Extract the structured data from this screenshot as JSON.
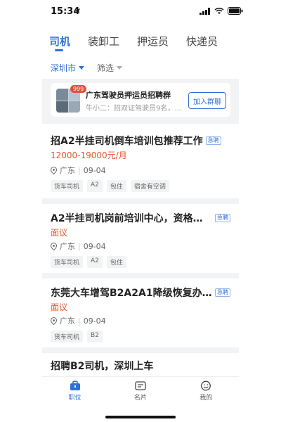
{
  "status": {
    "time": "15:34"
  },
  "tabs": [
    {
      "label": "司机",
      "active": true
    },
    {
      "label": "装卸工",
      "active": false
    },
    {
      "label": "押运员",
      "active": false
    },
    {
      "label": "快递员",
      "active": false
    }
  ],
  "filters": {
    "city": "深圳市",
    "filter": "筛选"
  },
  "group": {
    "badge": "999",
    "title": "广东驾驶员押运员招聘群",
    "subtitle": "牛小二：招双证驾驶员9名，工资…",
    "join_label": "加入群聊"
  },
  "jobs": [
    {
      "title": "招A2半挂司机倒车培训包推荐工作",
      "urgent": "急聘",
      "salary": "12000-19000元/月",
      "location": "广东",
      "date": "09-04",
      "tags": [
        "货车司机",
        "A2",
        "包住",
        "宿舍有空调"
      ]
    },
    {
      "title": "A2半挂司机岗前培训中心，资格证...",
      "urgent": "急聘",
      "salary": "面议",
      "location": "广东",
      "date": "09-04",
      "tags": [
        "货车司机",
        "A2",
        "包住"
      ]
    },
    {
      "title": "东莞大车增驾B2A2A1降级恢复办上...",
      "urgent": "急聘",
      "salary": "面议",
      "location": "广东",
      "date": "09-04",
      "tags": [
        "货车司机",
        "B2"
      ]
    },
    {
      "title": "招聘B2司机，深圳上车"
    }
  ],
  "nav": [
    {
      "label": "职位",
      "icon": "briefcase-icon",
      "active": true
    },
    {
      "label": "名片",
      "icon": "card-icon",
      "active": false
    },
    {
      "label": "我的",
      "icon": "smiley-icon",
      "active": false
    }
  ],
  "colors": {
    "accent": "#2f6fd8",
    "salary": "#e4572e",
    "band": "#f2f3f5"
  }
}
